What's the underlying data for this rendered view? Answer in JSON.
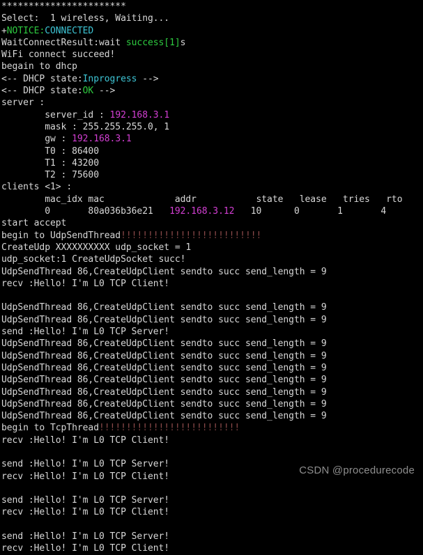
{
  "terminal": {
    "background_color": "#000000",
    "default_text_color": "#d8d8d8",
    "colors": {
      "green": "#2ecc40",
      "cyan": "#3ec6d6",
      "magenta": "#d43fd4",
      "red": "#8c4a4a",
      "white": "#d8d8d8"
    },
    "lines": [
      {
        "id": "l0",
        "segments": [
          {
            "text": "***********************",
            "color": "white"
          }
        ]
      },
      {
        "id": "l1",
        "segments": [
          {
            "text": "Select:  1 wireless, Waiting...",
            "color": "white"
          }
        ]
      },
      {
        "id": "l2",
        "segments": [
          {
            "text": "+",
            "color": "white"
          },
          {
            "text": "NOTICE:",
            "color": "green"
          },
          {
            "text": "CONNECTED",
            "color": "cyan"
          }
        ]
      },
      {
        "id": "l3",
        "segments": [
          {
            "text": "WaitConnectResult:wait ",
            "color": "white"
          },
          {
            "text": "success[1]",
            "color": "green"
          },
          {
            "text": "s",
            "color": "white"
          }
        ]
      },
      {
        "id": "l4",
        "segments": [
          {
            "text": "WiFi connect succeed!",
            "color": "white"
          }
        ]
      },
      {
        "id": "l5",
        "segments": [
          {
            "text": "begain to dhcp",
            "color": "white"
          }
        ]
      },
      {
        "id": "l6",
        "segments": [
          {
            "text": "<-- DHCP state:",
            "color": "white"
          },
          {
            "text": "Inprogress",
            "color": "cyan"
          },
          {
            "text": " -->",
            "color": "white"
          }
        ]
      },
      {
        "id": "l7",
        "segments": [
          {
            "text": "<-- DHCP state:",
            "color": "white"
          },
          {
            "text": "OK",
            "color": "green"
          },
          {
            "text": " -->",
            "color": "white"
          }
        ]
      },
      {
        "id": "l8",
        "segments": [
          {
            "text": "server :",
            "color": "white"
          }
        ]
      },
      {
        "id": "l9",
        "segments": [
          {
            "text": "        server_id : ",
            "color": "white"
          },
          {
            "text": "192.168.3.1",
            "color": "magenta"
          }
        ]
      },
      {
        "id": "l10",
        "segments": [
          {
            "text": "        mask : 255.255.255.0, 1",
            "color": "white"
          }
        ]
      },
      {
        "id": "l11",
        "segments": [
          {
            "text": "        gw : ",
            "color": "white"
          },
          {
            "text": "192.168.3.1",
            "color": "magenta"
          }
        ]
      },
      {
        "id": "l12",
        "segments": [
          {
            "text": "        T0 : 86400",
            "color": "white"
          }
        ]
      },
      {
        "id": "l13",
        "segments": [
          {
            "text": "        T1 : 43200",
            "color": "white"
          }
        ]
      },
      {
        "id": "l14",
        "segments": [
          {
            "text": "        T2 : 75600",
            "color": "white"
          }
        ]
      },
      {
        "id": "l15",
        "segments": [
          {
            "text": "clients <1> :",
            "color": "white"
          }
        ]
      },
      {
        "id": "l16",
        "segments": [
          {
            "text": "        mac_idx mac             addr           state   lease   tries   rto",
            "color": "white"
          }
        ]
      },
      {
        "id": "l17",
        "segments": [
          {
            "text": "        0       80a036b36e21   ",
            "color": "white"
          },
          {
            "text": "192.168.3.12",
            "color": "magenta"
          },
          {
            "text": "   10      0       1       4",
            "color": "white"
          }
        ]
      },
      {
        "id": "l18",
        "segments": [
          {
            "text": "start accept",
            "color": "white"
          }
        ]
      },
      {
        "id": "l19",
        "segments": [
          {
            "text": "begin to UdpSendThread",
            "color": "white"
          },
          {
            "text": "!!!!!!!!!!!!!!!!!!!!!!!!!!",
            "color": "red"
          }
        ]
      },
      {
        "id": "l20",
        "segments": [
          {
            "text": "CreateUdp XXXXXXXXXX udp_socket = 1",
            "color": "white"
          }
        ]
      },
      {
        "id": "l21",
        "segments": [
          {
            "text": "udp_socket:1 CreateUdpSocket succ!",
            "color": "white"
          }
        ]
      },
      {
        "id": "l22",
        "segments": [
          {
            "text": "UdpSendThread 86,CreateUdpClient sendto succ send_length = 9",
            "color": "white"
          }
        ]
      },
      {
        "id": "l23",
        "segments": [
          {
            "text": "recv :Hello! I'm L0 TCP Client!",
            "color": "white"
          }
        ]
      },
      {
        "id": "l24",
        "segments": [
          {
            "text": "",
            "color": "white"
          }
        ]
      },
      {
        "id": "l25",
        "segments": [
          {
            "text": "UdpSendThread 86,CreateUdpClient sendto succ send_length = 9",
            "color": "white"
          }
        ]
      },
      {
        "id": "l26",
        "segments": [
          {
            "text": "UdpSendThread 86,CreateUdpClient sendto succ send_length = 9",
            "color": "white"
          }
        ]
      },
      {
        "id": "l27",
        "segments": [
          {
            "text": "send :Hello! I'm L0 TCP Server!",
            "color": "white"
          }
        ]
      },
      {
        "id": "l28",
        "segments": [
          {
            "text": "UdpSendThread 86,CreateUdpClient sendto succ send_length = 9",
            "color": "white"
          }
        ]
      },
      {
        "id": "l29",
        "segments": [
          {
            "text": "UdpSendThread 86,CreateUdpClient sendto succ send_length = 9",
            "color": "white"
          }
        ]
      },
      {
        "id": "l30",
        "segments": [
          {
            "text": "UdpSendThread 86,CreateUdpClient sendto succ send_length = 9",
            "color": "white"
          }
        ]
      },
      {
        "id": "l31",
        "segments": [
          {
            "text": "UdpSendThread 86,CreateUdpClient sendto succ send_length = 9",
            "color": "white"
          }
        ]
      },
      {
        "id": "l32",
        "segments": [
          {
            "text": "UdpSendThread 86,CreateUdpClient sendto succ send_length = 9",
            "color": "white"
          }
        ]
      },
      {
        "id": "l33",
        "segments": [
          {
            "text": "UdpSendThread 86,CreateUdpClient sendto succ send_length = 9",
            "color": "white"
          }
        ]
      },
      {
        "id": "l34",
        "segments": [
          {
            "text": "UdpSendThread 86,CreateUdpClient sendto succ send_length = 9",
            "color": "white"
          }
        ]
      },
      {
        "id": "l35",
        "segments": [
          {
            "text": "begin to TcpThread",
            "color": "white"
          },
          {
            "text": "!!!!!!!!!!!!!!!!!!!!!!!!!!",
            "color": "red"
          }
        ]
      },
      {
        "id": "l36",
        "segments": [
          {
            "text": "recv :Hello! I'm L0 TCP Client!",
            "color": "white"
          }
        ]
      },
      {
        "id": "l37",
        "segments": [
          {
            "text": "",
            "color": "white"
          }
        ]
      },
      {
        "id": "l38",
        "segments": [
          {
            "text": "send :Hello! I'm L0 TCP Server!",
            "color": "white"
          }
        ]
      },
      {
        "id": "l39",
        "segments": [
          {
            "text": "recv :Hello! I'm L0 TCP Client!",
            "color": "white"
          }
        ]
      },
      {
        "id": "l40",
        "segments": [
          {
            "text": "",
            "color": "white"
          }
        ]
      },
      {
        "id": "l41",
        "segments": [
          {
            "text": "send :Hello! I'm L0 TCP Server!",
            "color": "white"
          }
        ]
      },
      {
        "id": "l42",
        "segments": [
          {
            "text": "recv :Hello! I'm L0 TCP Client!",
            "color": "white"
          }
        ]
      },
      {
        "id": "l43",
        "segments": [
          {
            "text": "",
            "color": "white"
          }
        ]
      },
      {
        "id": "l44",
        "segments": [
          {
            "text": "send :Hello! I'm L0 TCP Server!",
            "color": "white"
          }
        ]
      },
      {
        "id": "l45",
        "segments": [
          {
            "text": "recv :Hello! I'm L0 TCP Client!",
            "color": "white"
          }
        ]
      }
    ]
  },
  "watermark": {
    "text": "CSDN @procedurecode",
    "color": "#8e8e8e"
  }
}
